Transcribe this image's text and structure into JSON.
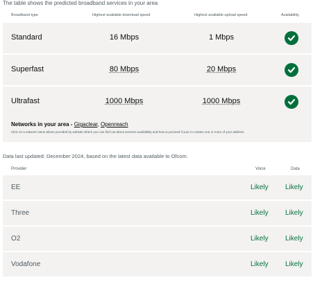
{
  "intro_text": "The table shows the predicted broadband services in your area",
  "broadband": {
    "headers": {
      "type": "Broadband type",
      "download": "Highest available download speed",
      "upload": "Highest available upload speed",
      "availability": "Availability"
    },
    "rows": [
      {
        "type": "Standard",
        "download": "16 Mbps",
        "upload": "1 Mbps",
        "available": true
      },
      {
        "type": "Superfast",
        "download": "80 Mbps",
        "upload": "20 Mbps",
        "available": true
      },
      {
        "type": "Ultrafast",
        "download": "1000 Mbps",
        "upload": "1000 Mbps",
        "available": true
      }
    ]
  },
  "networks": {
    "label": "Networks in your area - ",
    "providers": [
      "Gigaclear",
      "Openreach"
    ],
    "separator": ", ",
    "note": "Click on a network name above provided by website where you can find out about services availability and how to proceed if your to contact one or more of your address."
  },
  "data_updated": "Data last updated: December 2024, based on the latest data available to Ofcom.",
  "mobile": {
    "headers": {
      "provider": "Provider",
      "voice": "Voice",
      "data": "Data"
    },
    "rows": [
      {
        "provider": "EE",
        "voice": "Likely",
        "data": "Likely"
      },
      {
        "provider": "Three",
        "voice": "Likely",
        "data": "Likely"
      },
      {
        "provider": "O2",
        "voice": "Likely",
        "data": "Likely"
      },
      {
        "provider": "Vodafone",
        "voice": "Likely",
        "data": "Likely"
      }
    ]
  },
  "colors": {
    "accent_green": "#00703c",
    "row_bg": "#f3f2f1",
    "muted_text": "#505a5f"
  },
  "icons": {
    "available": "check-circle-icon"
  }
}
